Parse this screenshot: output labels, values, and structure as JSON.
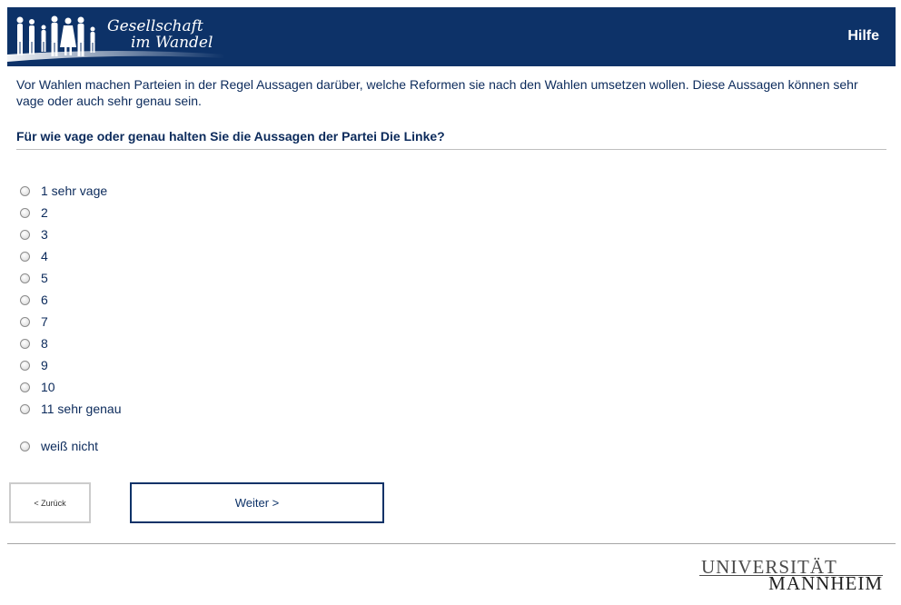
{
  "header": {
    "logo_line1": "Gesellschaft",
    "logo_line2": "im Wandel",
    "help_label": "Hilfe",
    "background_color": "#0d3268"
  },
  "intro_text": "Vor Wahlen machen Parteien in der Regel Aussagen darüber, welche Reformen sie nach den Wahlen umsetzen wollen. Diese Aussagen können sehr vage oder auch sehr genau sein.",
  "question": "Für wie vage oder genau halten Sie die Aussagen der Partei Die Linke?",
  "options": [
    {
      "label": "1 sehr vage",
      "selected": false
    },
    {
      "label": "2",
      "selected": false
    },
    {
      "label": "3",
      "selected": false
    },
    {
      "label": "4",
      "selected": false
    },
    {
      "label": "5",
      "selected": false
    },
    {
      "label": "6",
      "selected": false
    },
    {
      "label": "7",
      "selected": false
    },
    {
      "label": "8",
      "selected": false
    },
    {
      "label": "9",
      "selected": false
    },
    {
      "label": "10",
      "selected": false
    },
    {
      "label": "11 sehr genau",
      "selected": false
    }
  ],
  "dont_know_option": {
    "label": "weiß nicht",
    "selected": false
  },
  "navigation": {
    "back_label": "< Zurück",
    "next_label": "Weiter >"
  },
  "footer": {
    "logo_line1": "UNIVERSITÄT",
    "logo_line2": "MANNHEIM"
  }
}
